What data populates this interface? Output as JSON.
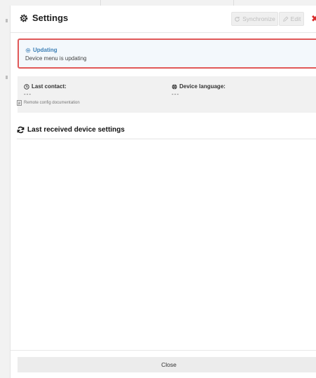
{
  "header": {
    "title": "Settings",
    "title_icon": "gear-icon",
    "sync_label": "Synchronize",
    "edit_label": "Edit",
    "close_glyph": "✖"
  },
  "alert": {
    "title": "Updating",
    "title_icon": "gear-icon",
    "text": "Device menu is updating",
    "border_color": "#e15858",
    "title_color": "#3b7fb6"
  },
  "info": {
    "last_contact_label": "Last contact:",
    "last_contact_value": "---",
    "device_language_label": "Device language:",
    "device_language_value": "---",
    "doc_link": "Remote config documentation"
  },
  "section": {
    "title": "Last received device settings",
    "title_icon": "refresh-icon"
  },
  "footer": {
    "close_label": "Close"
  },
  "colors": {
    "accent_red": "#d92a2a",
    "disabled_text": "#bdbdbd",
    "panel_bg": "#f1f1f1"
  }
}
